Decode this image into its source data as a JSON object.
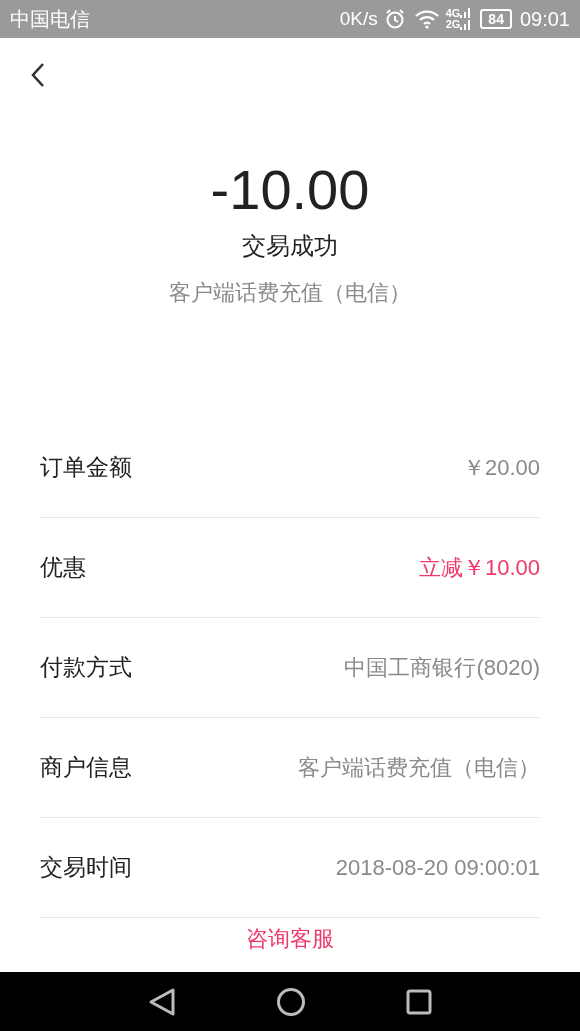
{
  "status_bar": {
    "carrier": "中国电信",
    "speed": "0K/s",
    "network_top": "4G",
    "network_bottom": "2G",
    "battery": "84",
    "time": "09:01"
  },
  "summary": {
    "amount": "-10.00",
    "status": "交易成功",
    "description": "客户端话费充值（电信）"
  },
  "details": [
    {
      "label": "订单金额",
      "value": "￥20.00",
      "kind": "plain"
    },
    {
      "label": "优惠",
      "value": "立减￥10.00",
      "kind": "accent"
    },
    {
      "label": "付款方式",
      "value": "中国工商银行(8020)",
      "kind": "plain"
    },
    {
      "label": "商户信息",
      "value": "客户端话费充值（电信）",
      "kind": "plain"
    },
    {
      "label": "交易时间",
      "value": "2018-08-20 09:00:01",
      "kind": "plain"
    }
  ],
  "service_link": "咨询客服"
}
